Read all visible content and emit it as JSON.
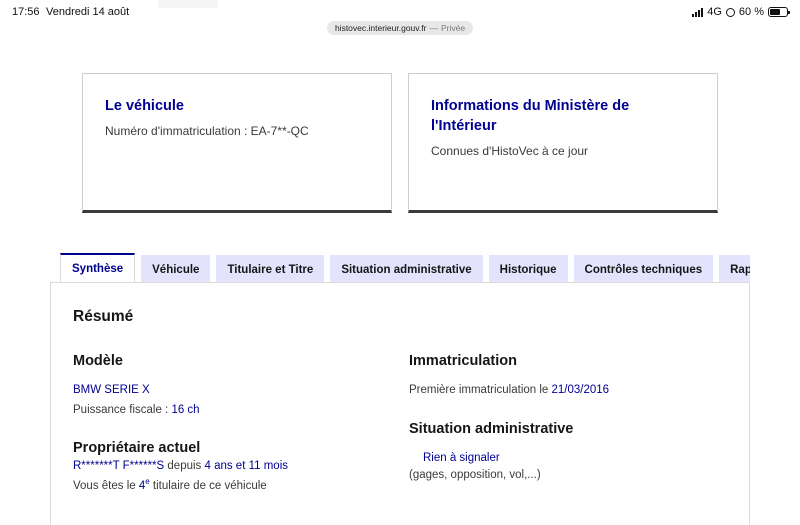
{
  "status": {
    "time": "17:56",
    "date": "Vendredi 14 août",
    "network": "4G",
    "battery_text": "60 %",
    "battery_level": 0.6
  },
  "url": {
    "host": "histovec.interieur.gouv.fr",
    "separator": "—",
    "mode": "Privée"
  },
  "cards": {
    "vehicle": {
      "title": "Le véhicule",
      "text": "Numéro d'immatriculation : EA-7**-QC"
    },
    "ministry": {
      "title": "Informations du Ministère de l'Intérieur",
      "text": "Connues d'HistoVec à ce jour"
    }
  },
  "tabs": [
    {
      "label": "Synthèse",
      "active": true
    },
    {
      "label": "Véhicule",
      "active": false
    },
    {
      "label": "Titulaire et Titre",
      "active": false
    },
    {
      "label": "Situation administrative",
      "active": false
    },
    {
      "label": "Historique",
      "active": false
    },
    {
      "label": "Contrôles techniques",
      "active": false
    },
    {
      "label": "Rap",
      "active": false
    }
  ],
  "summary": {
    "title": "Résumé",
    "model": {
      "heading": "Modèle",
      "name": "BMW SERIE X",
      "power_label": "Puissance fiscale : ",
      "power_value": "16 ch"
    },
    "owner": {
      "heading": "Propriétaire actuel",
      "name": "R*******T F******S",
      "since_label": " depuis ",
      "since_value": "4 ans et 11 mois",
      "rank_prefix": "Vous êtes le ",
      "rank_number": "4",
      "rank_sup": "e",
      "rank_suffix": " titulaire de ce véhicule"
    },
    "registration": {
      "heading": "Immatriculation",
      "label": "Première immatriculation le ",
      "date": "21/03/2016"
    },
    "admin": {
      "heading": "Situation administrative",
      "status": "Rien à signaler",
      "detail": "(gages, opposition, vol,...)"
    }
  }
}
